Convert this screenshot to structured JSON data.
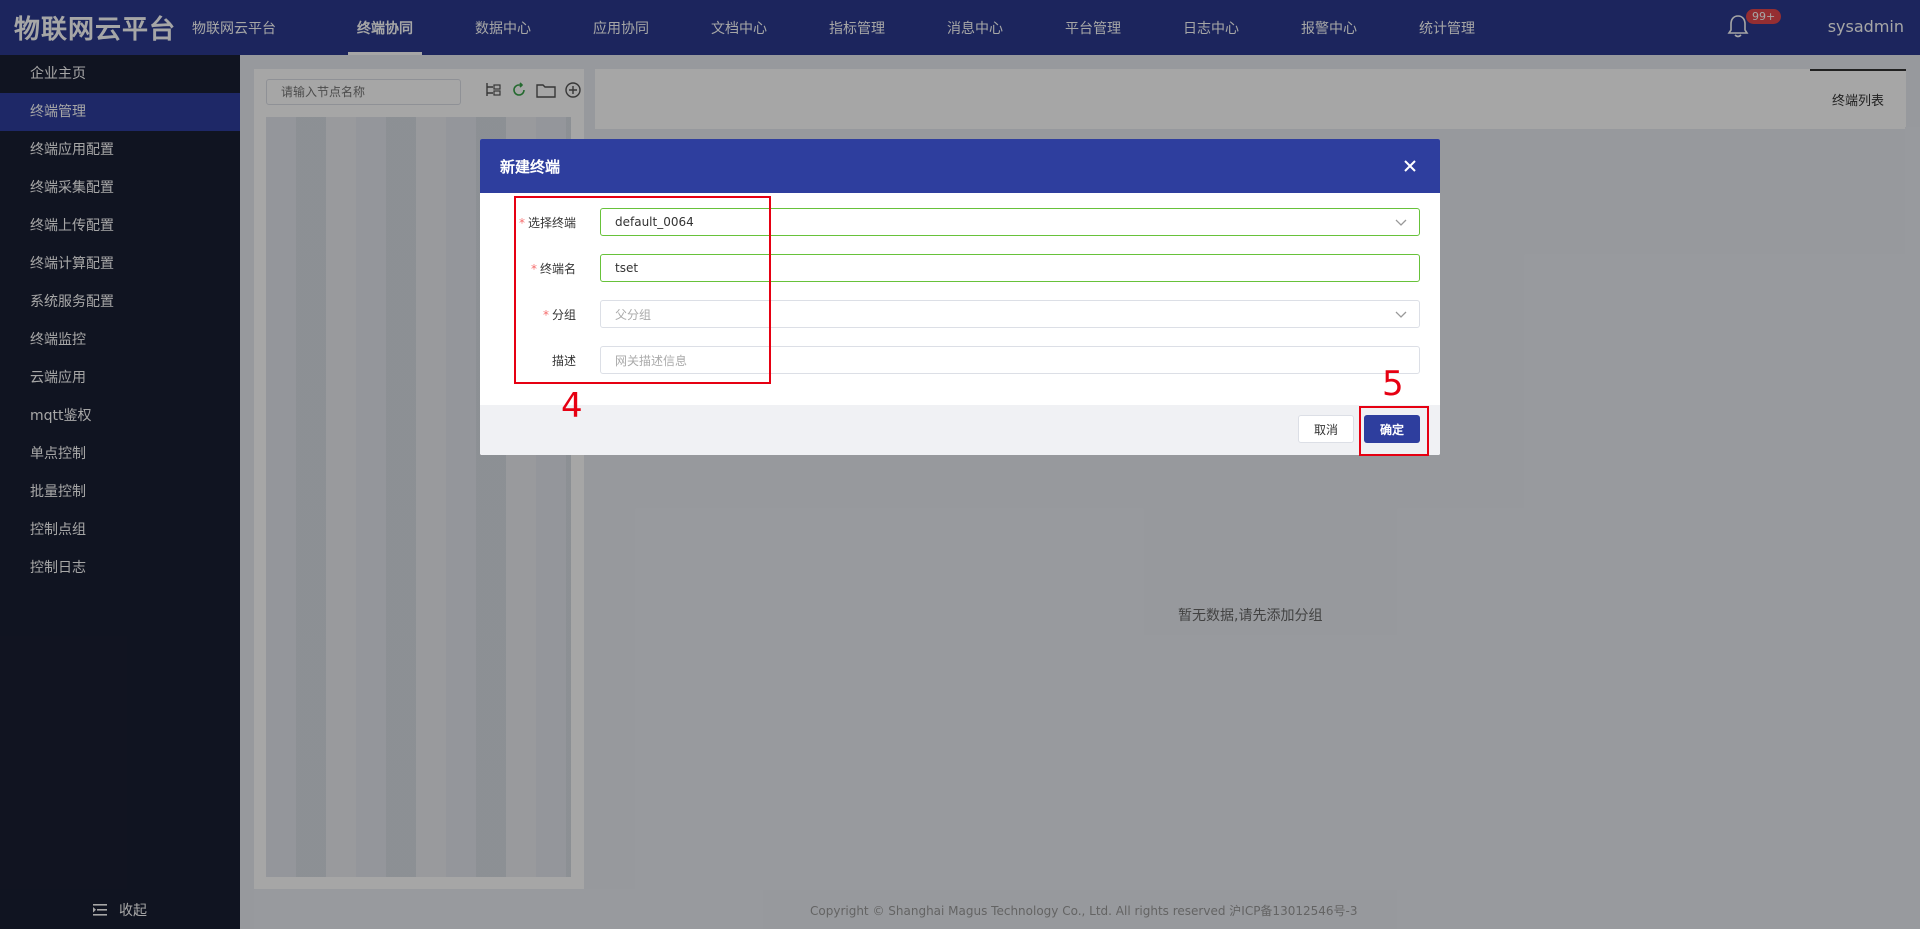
{
  "header": {
    "logo": "物联网云平台",
    "subtitle": "物联网云平台",
    "nav": [
      {
        "label": "终端协同",
        "active": true
      },
      {
        "label": "数据中心"
      },
      {
        "label": "应用协同"
      },
      {
        "label": "文档中心"
      },
      {
        "label": "指标管理"
      },
      {
        "label": "消息中心"
      },
      {
        "label": "平台管理"
      },
      {
        "label": "日志中心"
      },
      {
        "label": "报警中心"
      },
      {
        "label": "统计管理"
      }
    ],
    "badge": "99+",
    "user": "sysadmin"
  },
  "sidebar": {
    "items": [
      {
        "label": "企业主页"
      },
      {
        "label": "终端管理",
        "active": true
      },
      {
        "label": "终端应用配置"
      },
      {
        "label": "终端采集配置"
      },
      {
        "label": "终端上传配置"
      },
      {
        "label": "终端计算配置"
      },
      {
        "label": "系统服务配置"
      },
      {
        "label": "终端监控"
      },
      {
        "label": "云端应用"
      },
      {
        "label": "mqtt鉴权"
      },
      {
        "label": "单点控制"
      },
      {
        "label": "批量控制"
      },
      {
        "label": "控制点组"
      },
      {
        "label": "控制日志"
      }
    ],
    "collapse": "收起"
  },
  "tree": {
    "search_placeholder": "请输入节点名称"
  },
  "main": {
    "tab": "终端列表",
    "empty": "暂无数据,请先添加分组"
  },
  "footer": {
    "text": "Copyright © Shanghai Magus Technology Co., Ltd. All rights reserved     沪ICP备13012546号-3"
  },
  "dialog": {
    "title": "新建终端",
    "fields": [
      {
        "label": "选择终端",
        "required": true,
        "value": "default_0064",
        "placeholder": ""
      },
      {
        "label": "终端名",
        "required": true,
        "value": "tset",
        "placeholder": ""
      },
      {
        "label": "分组",
        "required": true,
        "value": "",
        "placeholder": "父分组"
      },
      {
        "label": "描述",
        "required": false,
        "value": "",
        "placeholder": "网关描述信息"
      }
    ],
    "cancel": "取消",
    "ok": "确定"
  },
  "annotations": {
    "step4": "4",
    "step5": "5"
  },
  "colors": {
    "header_bg": "#2b3a8f",
    "sidebar_bg": "#1a1f33",
    "primary": "#2e3e9e",
    "annotation": "#e60012",
    "valid": "#67c23a"
  }
}
